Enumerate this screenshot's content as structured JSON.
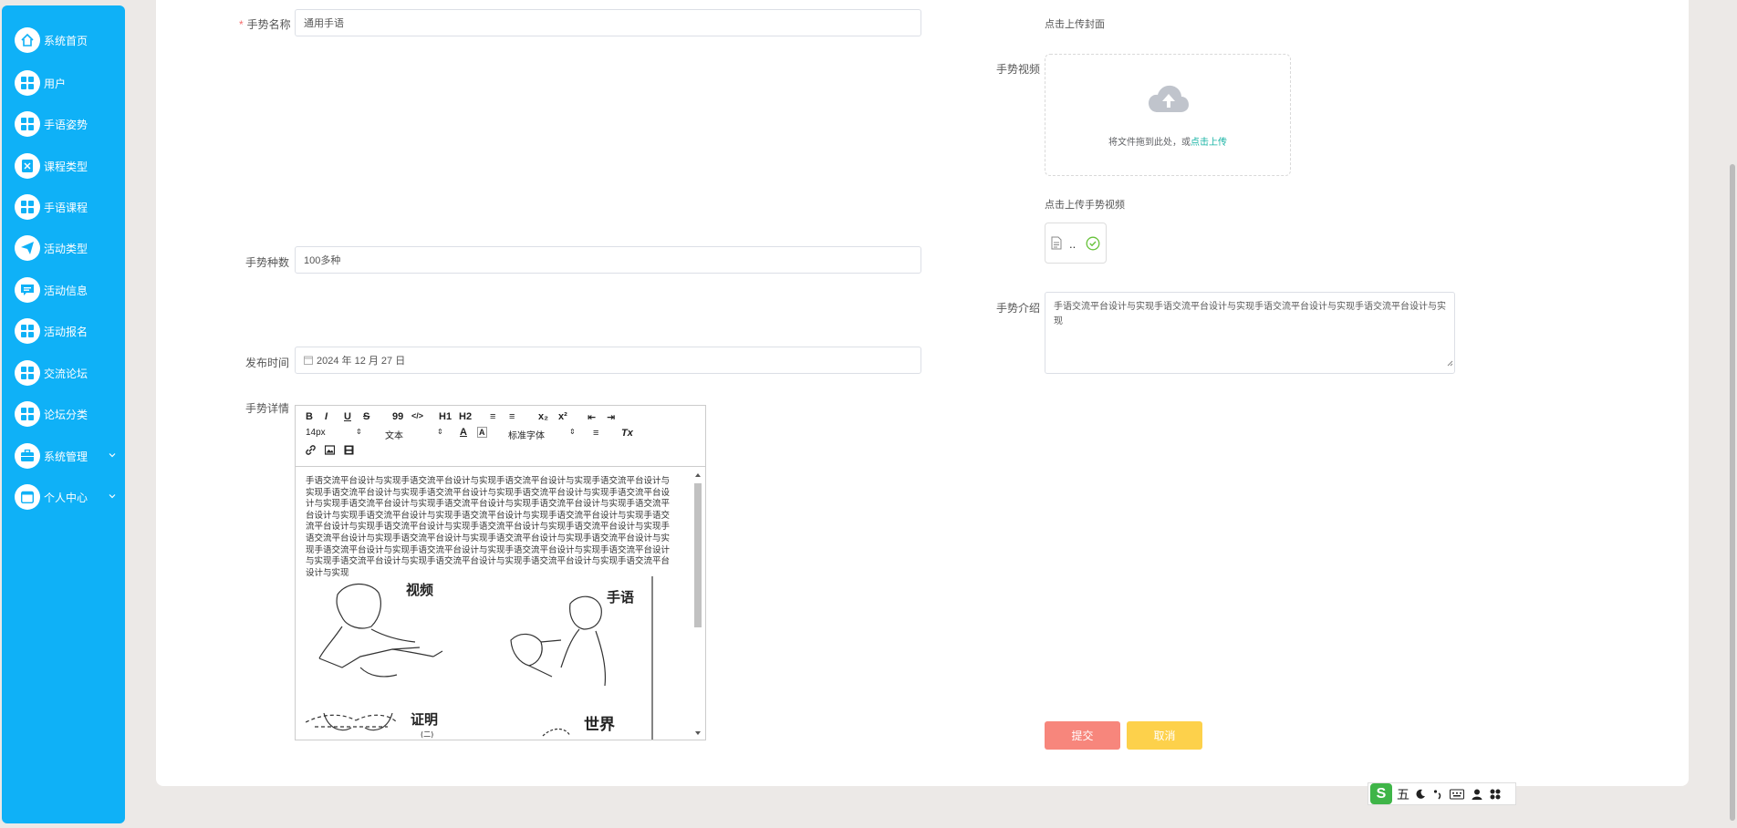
{
  "sidebar": {
    "items": [
      {
        "label": "系统首页",
        "icon": "home-icon"
      },
      {
        "label": "用户",
        "icon": "grid-icon"
      },
      {
        "label": "手语姿势",
        "icon": "grid-icon"
      },
      {
        "label": "课程类型",
        "icon": "excel-icon"
      },
      {
        "label": "手语课程",
        "icon": "grid-icon"
      },
      {
        "label": "活动类型",
        "icon": "send-icon"
      },
      {
        "label": "活动信息",
        "icon": "message-icon"
      },
      {
        "label": "活动报名",
        "icon": "grid-icon"
      },
      {
        "label": "交流论坛",
        "icon": "grid-icon"
      },
      {
        "label": "论坛分类",
        "icon": "grid-icon"
      },
      {
        "label": "系统管理",
        "icon": "briefcase-icon",
        "chevron": "⌄"
      },
      {
        "label": "个人中心",
        "icon": "calendar-icon",
        "chevron": "⌄"
      }
    ]
  },
  "form": {
    "name_label": "手势名称",
    "name_required_mark": "*",
    "name_value": "通用手语",
    "count_label": "手势种数",
    "count_value": "100多种",
    "date_label": "发布时间",
    "date_value": "2024 年 12 月 27 日",
    "detail_label": "手势详情",
    "cover_hint": "点击上传封面",
    "video_label": "手势视频",
    "upload_text": "将文件拖到此处，或",
    "upload_link": "点击上传",
    "video_hint": "点击上传手势视频",
    "file_name": "..",
    "intro_label": "手势介绍",
    "intro_value": "手语交流平台设计与实现手语交流平台设计与实现手语交流平台设计与实现手语交流平台设计与实现",
    "submit_label": "提交",
    "cancel_label": "取消"
  },
  "editor": {
    "toolbar": {
      "bold": "B",
      "italic": "I",
      "underline": "U",
      "strike": "S",
      "quote": "99",
      "code": "</>",
      "h1": "H1",
      "h2": "H2",
      "ol": "≡",
      "ul": "≡",
      "sub": "x₂",
      "sup": "x²",
      "indent_less": "⇤",
      "indent_more": "⇥",
      "size": "14px",
      "text_type": "文本",
      "font": "标准字体",
      "align": "≡",
      "clear": "Tx"
    },
    "body_text": "手语交流平台设计与实现手语交流平台设计与实现手语交流平台设计与实现手语交流平台设计与实现手语交流平台设计与实现手语交流平台设计与实现手语交流平台设计与实现手语交流平台设计与实现手语交流平台设计与实现手语交流平台设计与实现手语交流平台设计与实现手语交流平台设计与实现手语交流平台设计与实现手语交流平台设计与实现手语交流平台设计与实现手语交流平台设计与实现手语交流平台设计与实现手语交流平台设计与实现手语交流平台设计与实现手语交流平台设计与实现手语交流平台设计与实现手语交流平台设计与实现手语交流平台设计与实现手语交流平台设计与实现手语交流平台设计与实现手语交流平台设计与实现手语交流平台设计与实现手语交流平台设计与实现手语交流平台设计与实现手语交流平台设计与实现手语交流平台设计与实现",
    "image_words": [
      "视频",
      "手语",
      "证明",
      "(二)",
      "世界"
    ]
  },
  "ime": {
    "text": "五"
  },
  "colors": {
    "sidebar": "#0fb1f7",
    "submit": "#f7867c",
    "cancel": "#fdd14b",
    "link": "#17b3a4",
    "success": "#67c23a"
  }
}
